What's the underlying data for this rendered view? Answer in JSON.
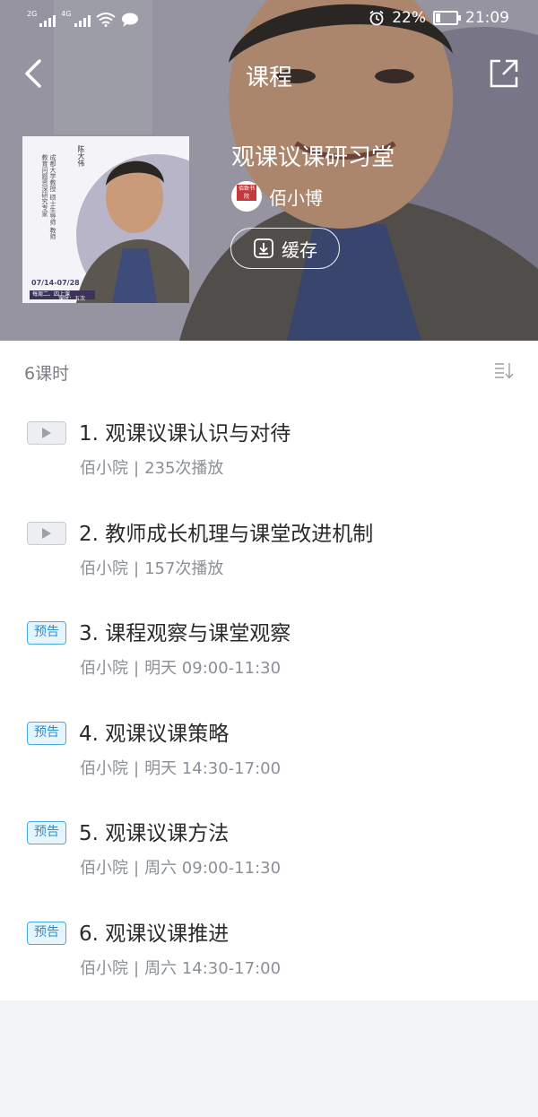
{
  "status_bar": {
    "net1": "2G",
    "net2": "4G",
    "battery_percent": "22%",
    "battery_level": 0.22,
    "time": "21:09"
  },
  "header": {
    "title": "课程",
    "back_icon": "chevron-left-icon",
    "share_icon": "share-icon"
  },
  "course": {
    "title": "观课议课研习堂",
    "author": "佰小博",
    "author_logo_text": "佰致书院",
    "cache_label": "缓存",
    "cover": {
      "name": "陈大伟",
      "desc": "成都大学教授 硕士生导师 教师教育问题资深研究专家",
      "dates": "07/14-07/28",
      "schedule": "每周二、四上课",
      "hours": "课时：五次"
    }
  },
  "lessons_header": {
    "count_label": "6课时"
  },
  "lessons": [
    {
      "type": "play",
      "title": "1. 观课议课认识与对待",
      "author": "佰小院",
      "info": "235次播放"
    },
    {
      "type": "play",
      "title": "2. 教师成长机理与课堂改进机制",
      "author": "佰小院",
      "info": "157次播放"
    },
    {
      "type": "preview",
      "badge": "预告",
      "title": "3. 课程观察与课堂观察",
      "author": "佰小院",
      "info": "明天 09:00-11:30"
    },
    {
      "type": "preview",
      "badge": "预告",
      "title": "4. 观课议课策略",
      "author": "佰小院",
      "info": "明天 14:30-17:00"
    },
    {
      "type": "preview",
      "badge": "预告",
      "title": "5. 观课议课方法",
      "author": "佰小院",
      "info": "周六 09:00-11:30"
    },
    {
      "type": "preview",
      "badge": "预告",
      "title": "6. 观课议课推进",
      "author": "佰小院",
      "info": "周六 14:30-17:00"
    }
  ],
  "colors": {
    "preview_accent": "#2f8fce",
    "meta_text": "#8b8f96",
    "page_bg": "#f2f3f5"
  }
}
